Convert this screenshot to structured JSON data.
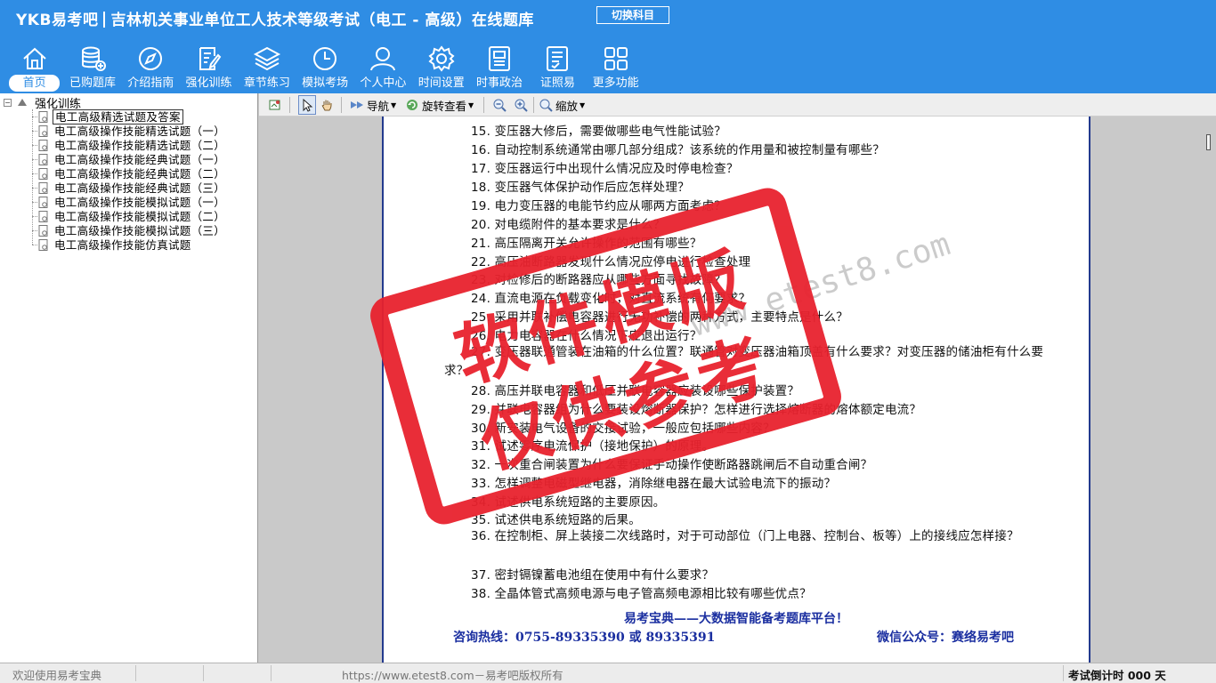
{
  "header": {
    "logo": "YKB易考吧",
    "title": "吉林机关事业单位工人技术等级考试（电工 - 高级）在线题库",
    "switch_label": "切换科目"
  },
  "nav": [
    {
      "label": "首页",
      "icon": "home-icon"
    },
    {
      "label": "已购题库",
      "icon": "database-icon"
    },
    {
      "label": "介绍指南",
      "icon": "compass-icon"
    },
    {
      "label": "强化训练",
      "icon": "edit-icon"
    },
    {
      "label": "章节练习",
      "icon": "layers-icon"
    },
    {
      "label": "模拟考场",
      "icon": "clock-icon"
    },
    {
      "label": "个人中心",
      "icon": "user-icon"
    },
    {
      "label": "时间设置",
      "icon": "gear-icon"
    },
    {
      "label": "时事政治",
      "icon": "news-icon"
    },
    {
      "label": "证照易",
      "icon": "certificate-icon"
    },
    {
      "label": "更多功能",
      "icon": "grid-icon"
    }
  ],
  "tree": {
    "root": "强化训练",
    "items": [
      "电工高级精选试题及答案",
      "电工高级操作技能精选试题（一）",
      "电工高级操作技能精选试题（二）",
      "电工高级操作技能经典试题（一）",
      "电工高级操作技能经典试题（二）",
      "电工高级操作技能经典试题（三）",
      "电工高级操作技能模拟试题（一）",
      "电工高级操作技能模拟试题（二）",
      "电工高级操作技能模拟试题（三）",
      "电工高级操作技能仿真试题"
    ]
  },
  "toolbar": {
    "nav_label": "导航",
    "rotate_label": "旋转查看",
    "zoom_label": "缩放"
  },
  "document": {
    "questions": [
      "15. 变压器大修后，需要做哪些电气性能试验？",
      "16. 自动控制系统通常由哪几部分组成？该系统的作用量和被控制量有哪些？",
      "17. 变压器运行中出现什么情况应及时停电检查？",
      "18. 变压器气体保护动作后应怎样处理？",
      "19. 电力变压器的电能节约应从哪两方面考虑？",
      "20. 对电缆附件的基本要求是什么？",
      "21. 高压隔离开关允许操作的范围有哪些？",
      "22. 高压油断路器发现什么情况应停电进行检查处理",
      "23. 对检修后的断路器应从哪些方面寻找故障？",
      "24. 直流电源在负载变化时，对直流系统有何要求？",
      "25. 采用并联补偿电容器进行无功补偿的两种方式，主要特点是什么？",
      "26. 电力电容器在什么情况下应退出运行？",
      "27. 变压器联通管装在油箱的什么位置？联通管对变压器油箱顶盖有什么要求？对变压器的储油柜有什么要求？",
      "28. 高压并联电容器和低压并联电容器应装设哪些保护装置？",
      "29. 并联电容器组为什么要装设熔断器保护？怎样进行选择熔断器的熔体额定电流？",
      "30. 新安装电气设备的交接试验，一般应包括哪些内容？",
      "31. 试述零序电流保护（接地保护）的原理。",
      "32. 一次重合闸装置为什么要保证手动操作使断路器跳闸后不自动重合闸？",
      "33. 怎样调整电磁型继电器，消除继电器在最大试验电流下的振动？",
      "34. 试述供电系统短路的主要原因。",
      "35. 试述供电系统短路的后果。",
      "36. 在控制柜、屏上装接二次线路时，对于可动部位（门上电器、控制台、板等）上的接线应怎样接？",
      "37. 密封镉镍蓄电池组在使用中有什么要求？",
      "38. 全晶体管式高频电源与电子管高频电源相比较有哪些优点？"
    ],
    "slogan": "易考宝典——大数据智能备考题库平台！",
    "hotline": "咨询热线：0755-89335390 或 89335391",
    "wechat": "微信公众号：赛络易考吧"
  },
  "watermark": {
    "line1": "软件模版",
    "line2": "仅供参考",
    "url": "www.etest8.com"
  },
  "status": {
    "left": "欢迎使用易考宝典",
    "center": "https://www.etest8.com－易考吧版权所有",
    "right": "考试倒计时 000 天"
  },
  "colors": {
    "header_bg": "#2f8de4",
    "stamp_red": "#e8222e",
    "footer_blue": "#1b2fa0"
  }
}
